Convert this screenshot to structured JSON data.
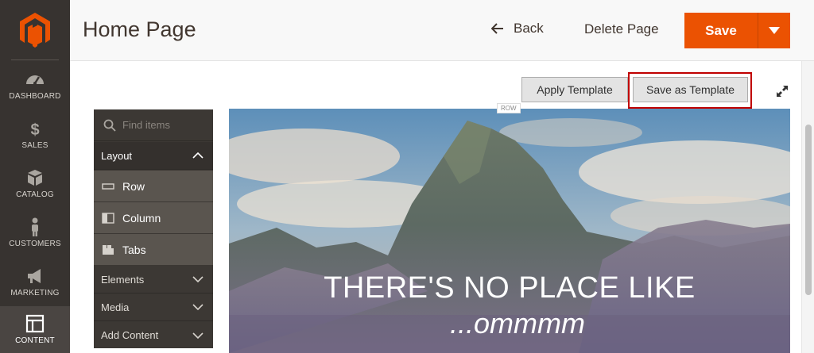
{
  "nav": {
    "items": [
      {
        "label": "DASHBOARD",
        "icon": "dashboard-icon"
      },
      {
        "label": "SALES",
        "icon": "dollar-icon"
      },
      {
        "label": "CATALOG",
        "icon": "box-icon"
      },
      {
        "label": "CUSTOMERS",
        "icon": "person-icon"
      },
      {
        "label": "MARKETING",
        "icon": "megaphone-icon"
      },
      {
        "label": "CONTENT",
        "icon": "layout-icon",
        "active": true
      }
    ]
  },
  "header": {
    "title": "Home Page",
    "back_label": "Back",
    "delete_label": "Delete Page",
    "save_label": "Save"
  },
  "toolbar": {
    "apply_template": "Apply Template",
    "save_as_template": "Save as Template"
  },
  "panel": {
    "search_placeholder": "Find items",
    "groups": [
      {
        "label": "Layout",
        "open": true,
        "items": [
          "Row",
          "Column",
          "Tabs"
        ]
      },
      {
        "label": "Elements",
        "open": false
      },
      {
        "label": "Media",
        "open": false
      },
      {
        "label": "Add Content",
        "open": false
      }
    ]
  },
  "stage": {
    "row_tag": "ROW",
    "headline": "THERE'S NO PLACE LIKE",
    "subline": "...ommmm"
  },
  "colors": {
    "accent": "#eb5202",
    "nav_bg": "#373330",
    "highlight": "#c00000"
  }
}
